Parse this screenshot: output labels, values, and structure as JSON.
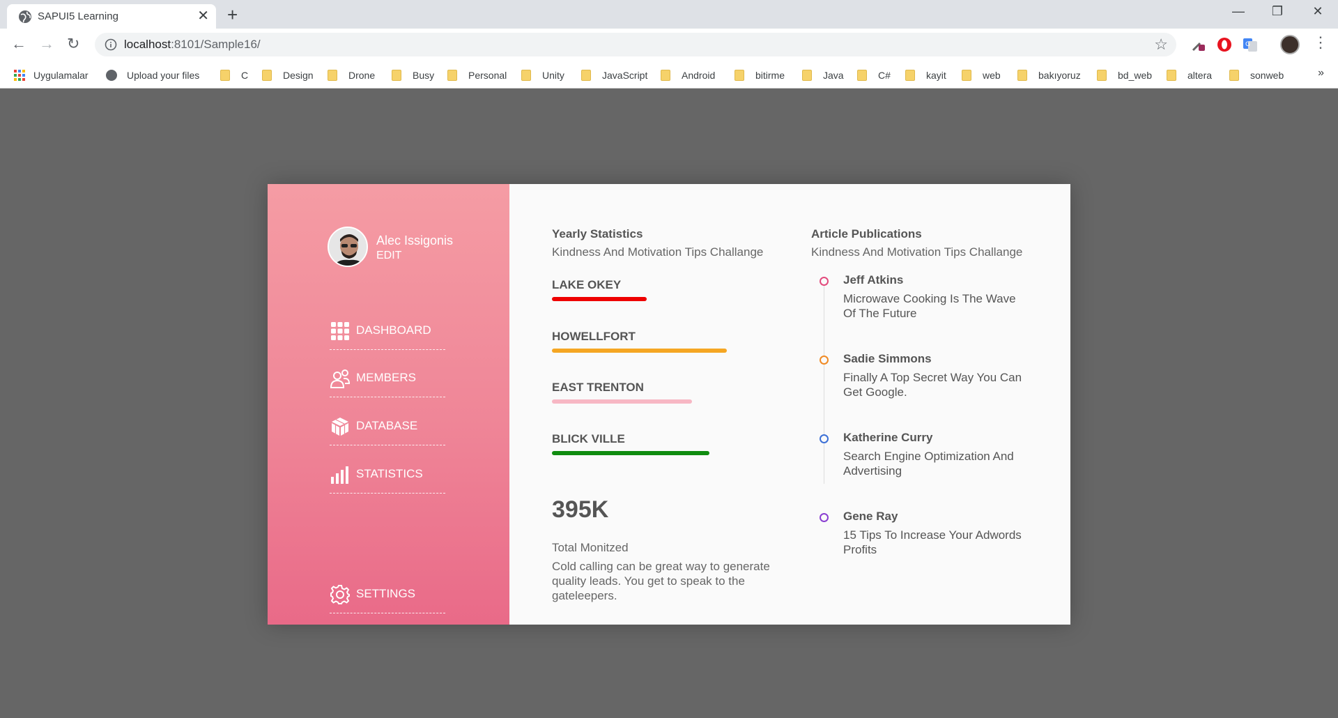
{
  "browser": {
    "tab_title": "SAPUI5 Learning",
    "url_host": "localhost",
    "url_rest": ":8101/Sample16/",
    "bookmarks": [
      "Uygulamalar",
      "Upload your files",
      "C",
      "Design",
      "Drone",
      "Busy",
      "Personal",
      "Unity",
      "JavaScript",
      "Android",
      "bitirme",
      "Java",
      "C#",
      "kayit",
      "web",
      "bakıyoruz",
      "bd_web",
      "altera",
      "sonweb"
    ],
    "more": "»"
  },
  "sidebar": {
    "user_name": "Alec Issigonis",
    "edit_label": "EDIT",
    "items": [
      {
        "label": "DASHBOARD",
        "icon": "grid-icon"
      },
      {
        "label": "MEMBERS",
        "icon": "users-icon"
      },
      {
        "label": "DATABASE",
        "icon": "cube-icon"
      },
      {
        "label": "STATISTICS",
        "icon": "bars-icon"
      },
      {
        "label": "SETTINGS",
        "icon": "gear-icon"
      }
    ]
  },
  "yearly": {
    "title": "Yearly Statistics",
    "subtitle": "Kindness And Motivation Tips Challange",
    "cities": [
      {
        "name": "LAKE OKEY",
        "color": "#ee0000",
        "value": 0.54
      },
      {
        "name": "HOWELLFORT",
        "color": "#f5a623",
        "value": 1.0
      },
      {
        "name": "EAST TRENTON",
        "color": "#f7b7c4",
        "value": 0.8
      },
      {
        "name": "BLICK VILLE",
        "color": "#108c10",
        "value": 0.9
      }
    ],
    "total": "395K",
    "total_label": "Total Monitzed",
    "total_desc": "Cold calling can be great way to generate quality leads. You get to speak to the gateleepers."
  },
  "articles": {
    "title": "Article Publications",
    "subtitle": "Kindness And Motivation Tips Challange",
    "items": [
      {
        "name": "Jeff Atkins",
        "text": "Microwave Cooking Is The Wave Of The Future",
        "color": "#e24a7c"
      },
      {
        "name": "Sadie Simmons",
        "text": "Finally A Top Secret Way You Can Get Google.",
        "color": "#f08a24"
      },
      {
        "name": "Katherine Curry",
        "text": "Search Engine Optimization And Advertising",
        "color": "#3b6fd6"
      },
      {
        "name": "Gene Ray",
        "text": "15 Tips To Increase Your Adwords Profits",
        "color": "#8a3fd1"
      }
    ]
  }
}
